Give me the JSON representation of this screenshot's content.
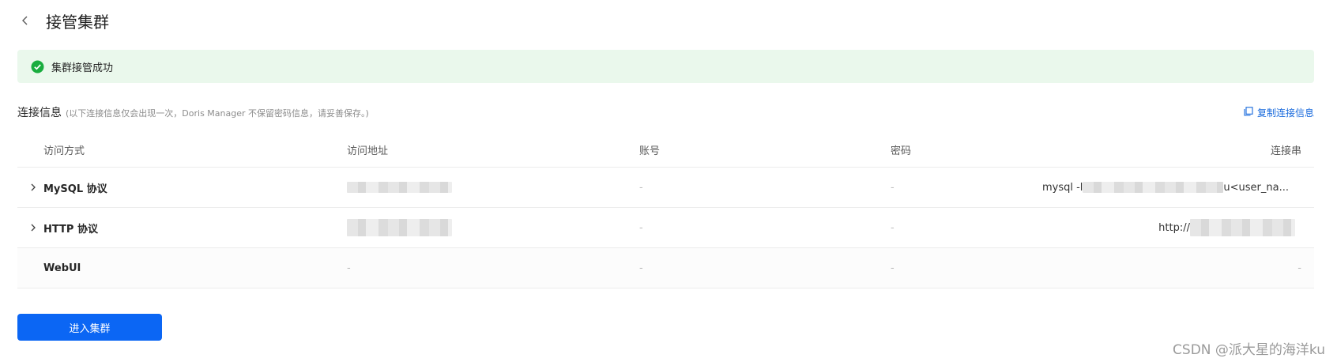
{
  "header": {
    "title": "接管集群"
  },
  "alert": {
    "text": "集群接管成功",
    "color": "#1aad3f"
  },
  "section": {
    "title": "连接信息",
    "note": "(以下连接信息仅会出现一次，Doris Manager 不保留密码信息，请妥善保存。)",
    "copy_label": "复制连接信息"
  },
  "table": {
    "headers": [
      "访问方式",
      "访问地址",
      "账号",
      "密码",
      "连接串"
    ],
    "rows": [
      {
        "method": "MySQL 协议",
        "address": "",
        "account": "-",
        "password": "-",
        "conn_prefix": "mysql -l",
        "conn_suffix": "u<user_na..."
      },
      {
        "method": "HTTP 协议",
        "address": "",
        "account": "-",
        "password": "-",
        "conn_prefix": "http://",
        "conn_suffix": ""
      },
      {
        "method": "WebUI",
        "address": "-",
        "account": "-",
        "password": "-",
        "conn_prefix": "-",
        "conn_suffix": ""
      }
    ]
  },
  "enter_button": {
    "label": "进入集群",
    "color": "#0b66f4"
  },
  "watermark": "CSDN @派大星的海洋ku"
}
